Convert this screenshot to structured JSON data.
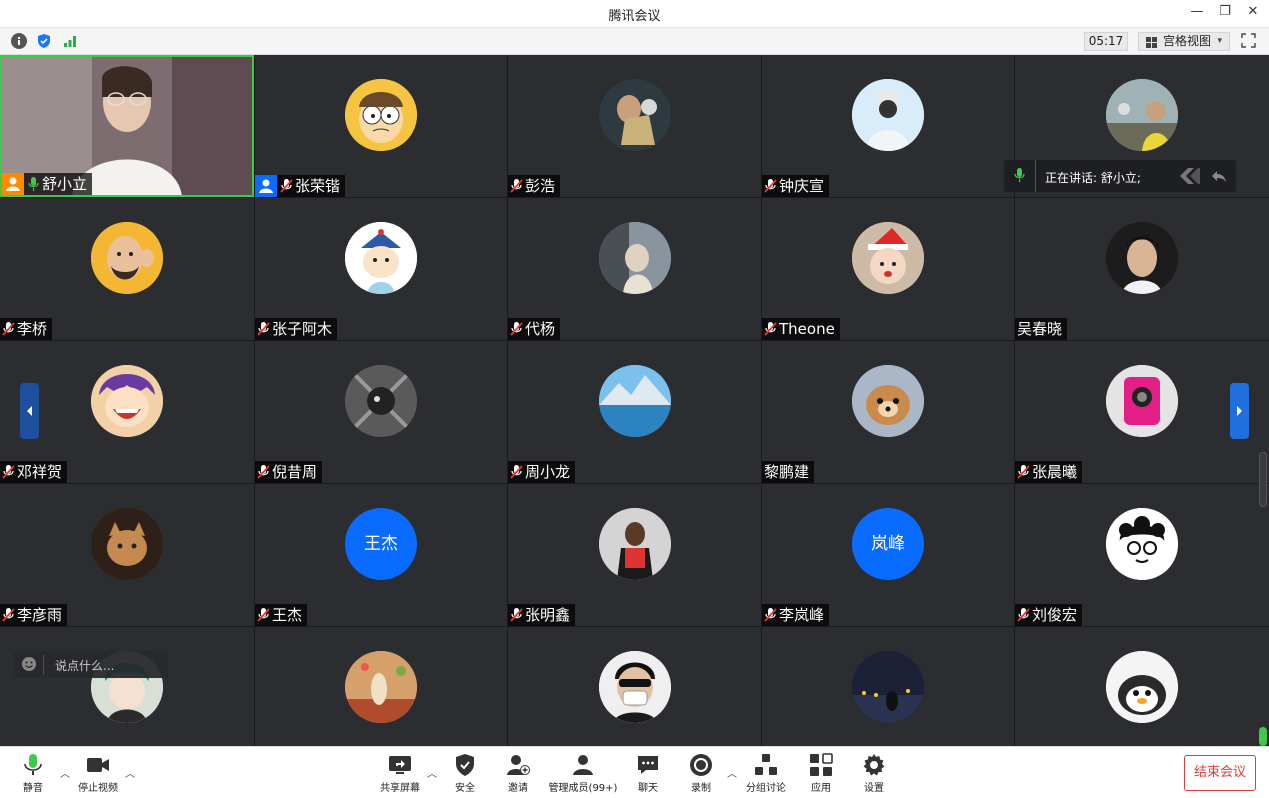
{
  "window": {
    "title": "腾讯会议",
    "minimize": "—",
    "restore": "❐",
    "close": "✕"
  },
  "infobar": {
    "timer": "05:17",
    "view_label": "宫格视图",
    "caret": "▾"
  },
  "speaking_indicator": "正在讲话: 舒小立;",
  "chat_placeholder": "说点什么...",
  "participants": [
    {
      "name": "舒小立",
      "role": "host-video",
      "muted": false
    },
    {
      "name": "张荣锴",
      "role": "cohost",
      "muted": true
    },
    {
      "name": "彭浩",
      "muted": true
    },
    {
      "name": "钟庆宣",
      "muted": true
    },
    {
      "name": "",
      "muted": true
    },
    {
      "name": "李桥",
      "muted": true
    },
    {
      "name": "张子阿木",
      "muted": true
    },
    {
      "name": "代杨",
      "muted": true
    },
    {
      "name": "Theone",
      "muted": true
    },
    {
      "name": "吴春晓",
      "muted": false,
      "nomic": true
    },
    {
      "name": "邓祥贺",
      "muted": true
    },
    {
      "name": "倪昔周",
      "muted": true
    },
    {
      "name": "周小龙",
      "muted": true
    },
    {
      "name": "黎鹏建",
      "muted": false,
      "nomic": true
    },
    {
      "name": "张晨曦",
      "muted": true
    },
    {
      "name": "李彦雨",
      "muted": true
    },
    {
      "name": "王杰",
      "muted": true,
      "avatar_text": "王杰"
    },
    {
      "name": "张明鑫",
      "muted": true
    },
    {
      "name": "李岚峰",
      "muted": true,
      "avatar_text": "岚峰"
    },
    {
      "name": "刘俊宏",
      "muted": true
    }
  ],
  "toolbar": {
    "mute": "静音",
    "stop_video": "停止视频",
    "share_screen": "共享屏幕",
    "security": "安全",
    "invite": "邀请",
    "manage_members": "管理成员(99+)",
    "chat": "聊天",
    "record": "录制",
    "breakout": "分组讨论",
    "apps": "应用",
    "settings": "设置",
    "end_meeting": "结束会议"
  },
  "colors": {
    "accent_blue": "#0a6cff",
    "end_red": "#e03c3c",
    "speaking_green": "#3ec94b",
    "tile_bg": "#2c2d31"
  }
}
